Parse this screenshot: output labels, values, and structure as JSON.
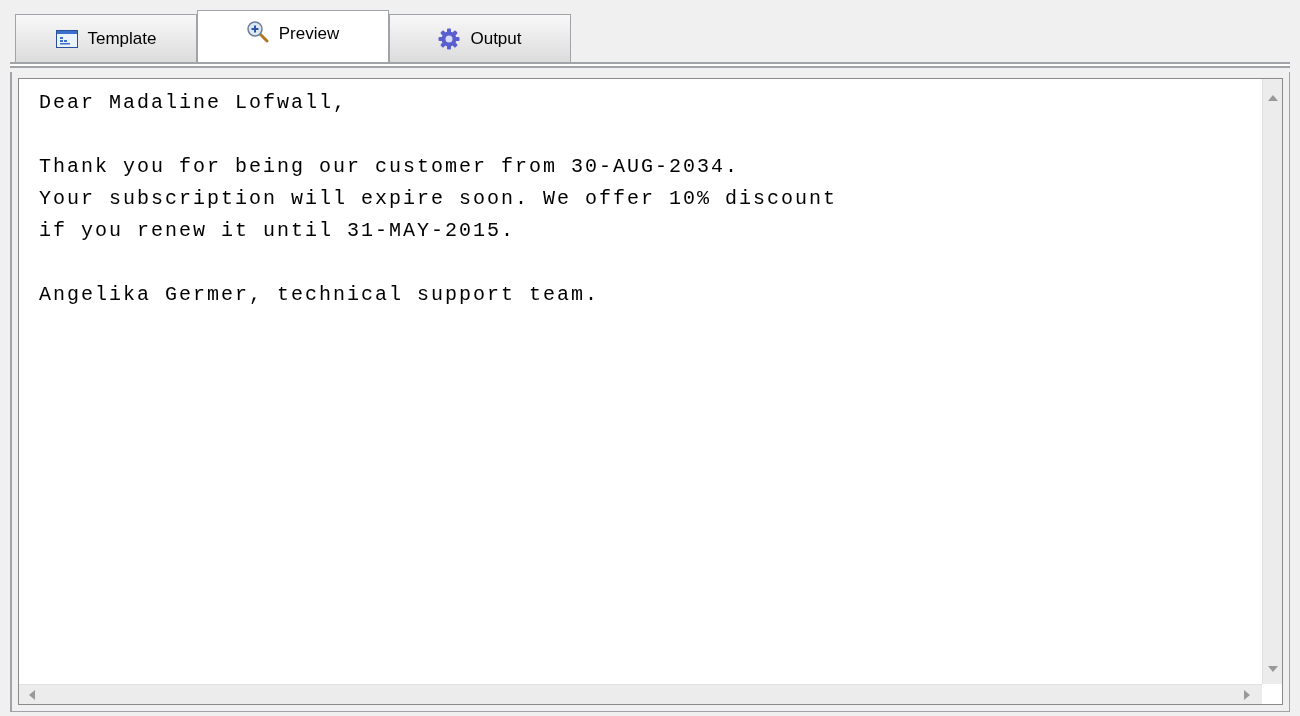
{
  "tabs": [
    {
      "label": "Template",
      "kind": "template",
      "selected": false
    },
    {
      "label": "Preview",
      "kind": "preview",
      "selected": true
    },
    {
      "label": "Output",
      "kind": "output",
      "selected": false
    }
  ],
  "preview": {
    "paragraphs": [
      {
        "lines": [
          "Dear Madaline Lofwall,"
        ]
      },
      {
        "lines": [
          "Thank you for being our customer from 30-AUG-2034.",
          "Your subscription will expire soon. We offer 10% discount",
          "if you renew it until 31-MAY-2015."
        ]
      },
      {
        "lines": [
          "Angelika Germer, technical support team."
        ]
      }
    ]
  }
}
